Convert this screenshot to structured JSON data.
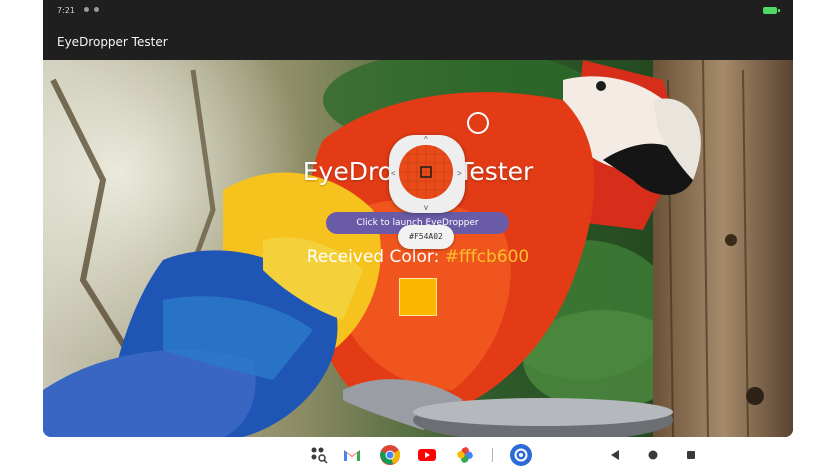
{
  "status_bar": {
    "time": "7:21"
  },
  "app_bar": {
    "title": "EyeDropper Tester"
  },
  "main": {
    "heading": "EyeDropper Tester",
    "launch_button_label": "Click to launch EyeDropper",
    "received_label": "Received Color: ",
    "received_value": "#fffcb600",
    "swatch_color": "#fbb600"
  },
  "eyedropper": {
    "hex_value": "#F54A02",
    "sampled_color": "#f54a02"
  },
  "taskbar": {
    "apps": [
      "apps-search-icon",
      "gmail-icon",
      "chrome-icon",
      "youtube-icon",
      "photos-icon",
      "settings-icon"
    ],
    "nav": [
      "back-icon",
      "home-icon",
      "recents-icon"
    ]
  }
}
